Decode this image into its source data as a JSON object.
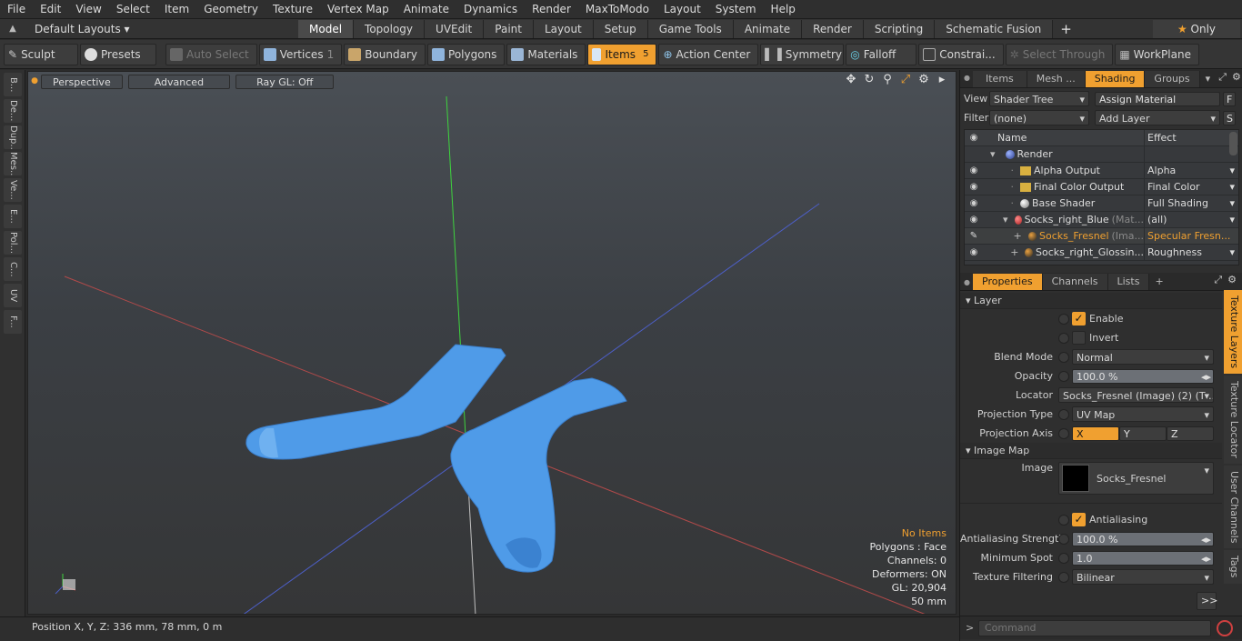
{
  "menu": [
    "File",
    "Edit",
    "View",
    "Select",
    "Item",
    "Geometry",
    "Texture",
    "Vertex Map",
    "Animate",
    "Dynamics",
    "Render",
    "MaxToModo",
    "Layout",
    "System",
    "Help"
  ],
  "layouts": {
    "default_label": "Default Layouts",
    "tabs": [
      "Model",
      "Topology",
      "UVEdit",
      "Paint",
      "Layout",
      "Setup",
      "Game Tools",
      "Animate",
      "Render",
      "Scripting",
      "Schematic Fusion"
    ],
    "active_tab": "Model",
    "only_label": "Only"
  },
  "toolbar": {
    "sculpt": "Sculpt",
    "presets": "Presets",
    "auto_select": "Auto Select",
    "vertices": "Vertices",
    "vertices_count": "1",
    "boundary": "Boundary",
    "polygons": "Polygons",
    "materials": "Materials",
    "items": "Items",
    "items_count": "5",
    "action_center": "Action Center",
    "symmetry": "Symmetry",
    "falloff": "Falloff",
    "constraints": "Constrai...",
    "select_through": "Select Through",
    "workplane": "WorkPlane"
  },
  "left_tabs": [
    "B...",
    "De...",
    "Dup...",
    "Mes...",
    "Ve...",
    "E...",
    "Pol...",
    "C...",
    "UV",
    "F..."
  ],
  "viewport": {
    "perspective": "Perspective",
    "advanced": "Advanced",
    "raygl": "Ray GL: Off",
    "stats": {
      "no_items": "No Items",
      "polygons": "Polygons : Face",
      "channels": "Channels: 0",
      "deformers": "Deformers: ON",
      "gl": "GL: 20,904",
      "scale": "50 mm"
    }
  },
  "status": {
    "position": "Position X, Y, Z:  336 mm, 78 mm, 0 m"
  },
  "shading_panel": {
    "tabs": [
      "Items",
      "Mesh ...",
      "Shading",
      "Groups"
    ],
    "active": "Shading",
    "view_label": "View",
    "view_value": "Shader Tree",
    "assign_material": "Assign Material",
    "filter_label": "Filter",
    "filter_value": "(none)",
    "add_layer": "Add Layer",
    "col_name": "Name",
    "col_effect": "Effect",
    "rows": [
      {
        "name": "Render",
        "suffix": "",
        "effect": ""
      },
      {
        "name": "Alpha Output",
        "suffix": "",
        "effect": "Alpha"
      },
      {
        "name": "Final Color Output",
        "suffix": "",
        "effect": "Final Color"
      },
      {
        "name": "Base Shader",
        "suffix": "",
        "effect": "Full Shading"
      },
      {
        "name": "Socks_right_Blue",
        "suffix": " (Mat...",
        "effect": "(all)"
      },
      {
        "name": "Socks_Fresnel",
        "suffix": " (Ima...",
        "effect": "Specular Fresn..."
      },
      {
        "name": "Socks_right_Glossin...",
        "suffix": "",
        "effect": "Roughness"
      }
    ]
  },
  "properties_panel": {
    "tabs": [
      "Properties",
      "Channels",
      "Lists"
    ],
    "active": "Properties",
    "layer_section": "Layer",
    "enable": "Enable",
    "invert": "Invert",
    "blend_mode_label": "Blend Mode",
    "blend_mode": "Normal",
    "opacity_label": "Opacity",
    "opacity": "100.0 %",
    "locator_label": "Locator",
    "locator": "Socks_Fresnel (Image) (2) (T ...",
    "projection_type_label": "Projection Type",
    "projection_type": "UV Map",
    "projection_axis_label": "Projection Axis",
    "axis_x": "X",
    "axis_y": "Y",
    "axis_z": "Z",
    "image_map_section": "Image Map",
    "image_label": "Image",
    "image_value": "Socks_Fresnel",
    "antialiasing": "Antialiasing",
    "aa_strength_label": "Antialiasing Strength",
    "aa_strength": "100.0 %",
    "min_spot_label": "Minimum Spot",
    "min_spot": "1.0",
    "tex_filter_label": "Texture Filtering",
    "tex_filter": "Bilinear",
    "more": ">>"
  },
  "side_tabs": [
    "Texture Layers",
    "Texture Locator",
    "User Channels",
    "Tags"
  ],
  "command": {
    "placeholder": "Command",
    "prompt": ">"
  }
}
